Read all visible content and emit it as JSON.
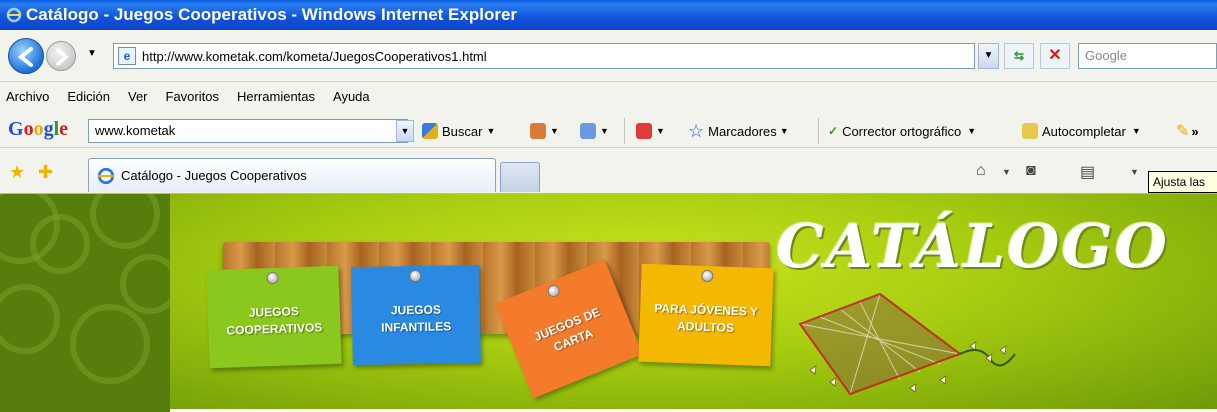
{
  "window": {
    "title": "Catálogo - Juegos Cooperativos - Windows Internet Explorer"
  },
  "address_bar": {
    "url": "http://www.kometak.com/kometa/JuegosCooperativos1.html",
    "search_placeholder": "Google"
  },
  "menu": {
    "items": [
      "Archivo",
      "Edición",
      "Ver",
      "Favoritos",
      "Herramientas",
      "Ayuda"
    ]
  },
  "google_toolbar": {
    "logo": "Google",
    "query": "www.kometak",
    "buscar_label": "Buscar",
    "marcadores_label": "Marcadores",
    "corrector_label": "Corrector ortográfico",
    "autocompletar_label": "Autocompletar"
  },
  "tabs": {
    "active_title": "Catálogo - Juegos Cooperativos"
  },
  "tooltip": {
    "text": "Ajusta las"
  },
  "banner": {
    "title": "CATÁLOGO",
    "cards": [
      {
        "label": "JUEGOS COOPERATIVOS",
        "color": "#8ac81e"
      },
      {
        "label": "JUEGOS INFANTILES",
        "color": "#2a8ae2"
      },
      {
        "label": "JUEGOS DE CARTA",
        "color": "#f47a2c"
      },
      {
        "label": "PARA JÓVENES Y ADULTOS",
        "color": "#f5b800"
      }
    ]
  },
  "colors": {
    "titlebar": "#0a5fe0",
    "banner_green": "#a6cc10",
    "left_panel": "#577d0c"
  }
}
